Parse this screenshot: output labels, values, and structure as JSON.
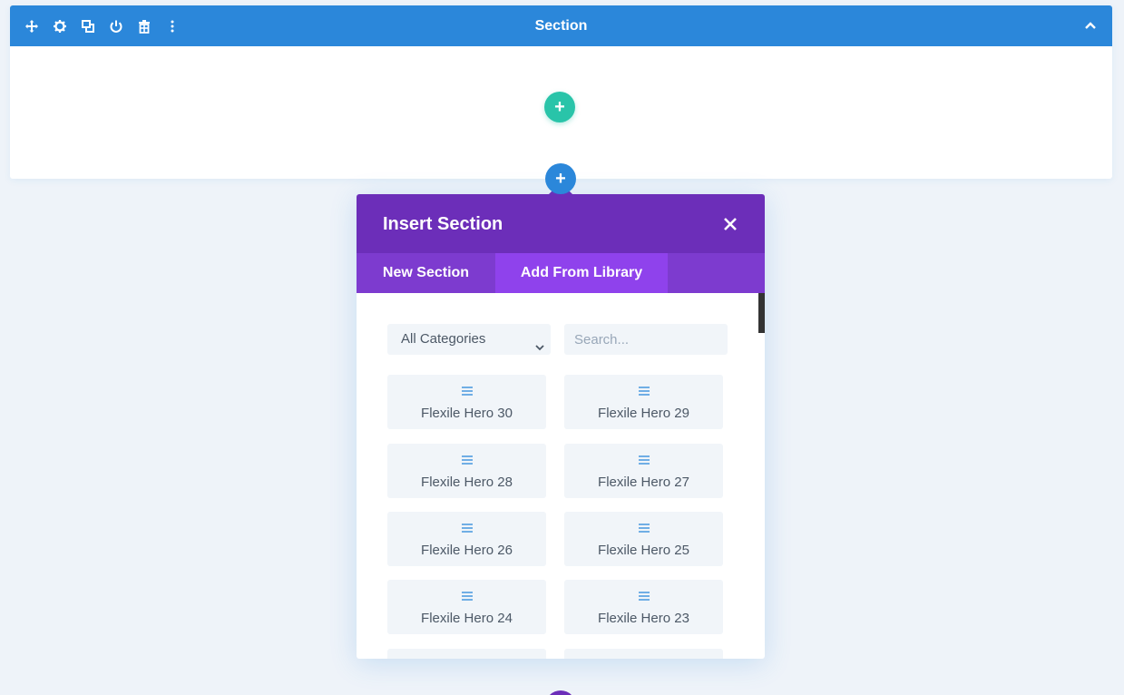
{
  "section": {
    "title": "Section",
    "toolbar_icons": [
      "move-icon",
      "gear-icon",
      "duplicate-icon",
      "power-icon",
      "trash-icon",
      "more-icon"
    ]
  },
  "add_row": {
    "label": "+"
  },
  "add_section": {
    "label": "+"
  },
  "modal": {
    "title": "Insert Section",
    "close_label": "✕",
    "tabs": [
      {
        "label": "New Section",
        "active": false
      },
      {
        "label": "Add From Library",
        "active": true
      }
    ],
    "filter": {
      "selected": "All Categories"
    },
    "search": {
      "placeholder": "Search..."
    },
    "items": [
      {
        "label": "Flexile Hero 30"
      },
      {
        "label": "Flexile Hero 29"
      },
      {
        "label": "Flexile Hero 28"
      },
      {
        "label": "Flexile Hero 27"
      },
      {
        "label": "Flexile Hero 26"
      },
      {
        "label": "Flexile Hero 25"
      },
      {
        "label": "Flexile Hero 24"
      },
      {
        "label": "Flexile Hero 23"
      },
      {
        "label": ""
      },
      {
        "label": ""
      }
    ]
  },
  "colors": {
    "section_bar": "#2b87da",
    "add_row": "#29c4a9",
    "modal_header": "#6c2eb9",
    "modal_tabs": "#7d3bcf",
    "active_tab": "#8f42ec",
    "background": "#eef3f9"
  }
}
